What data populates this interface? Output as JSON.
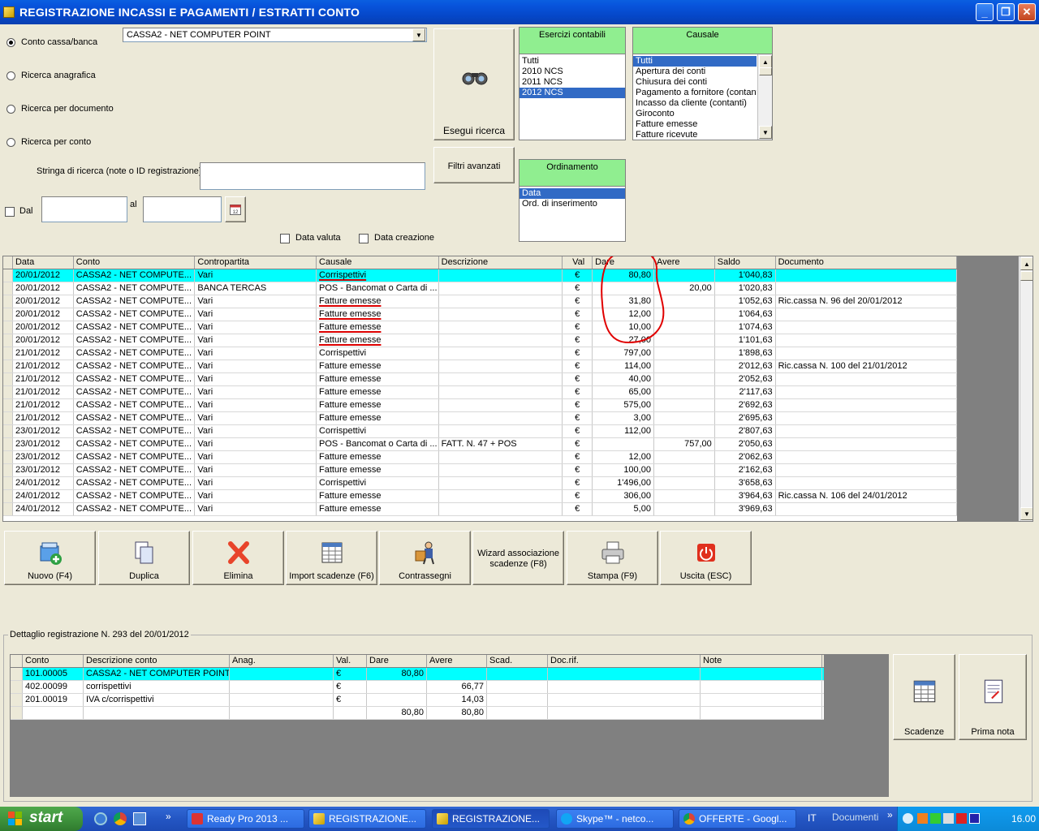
{
  "window": {
    "title": "REGISTRAZIONE INCASSI E PAGAMENTI / ESTRATTI CONTO"
  },
  "search": {
    "options": [
      "Conto cassa/banca",
      "Ricerca anagrafica",
      "Ricerca per documento",
      "Ricerca per conto"
    ],
    "selected_option": "Conto cassa/banca",
    "account_value": "CASSA2 - NET COMPUTER POINT",
    "search_string_label": "Stringa di ricerca (note o ID registrazione)",
    "search_string_value": "",
    "dal_label": "Dal",
    "al_label": "al",
    "data_valuta_label": "Data valuta",
    "data_creazione_label": "Data creazione",
    "run_button": "Esegui ricerca",
    "filters_button": "Filtri avanzati"
  },
  "esercizi": {
    "header": "Esercizi contabili",
    "items": [
      "Tutti",
      "2010 NCS",
      "2011 NCS",
      "2012 NCS"
    ],
    "selected": "2012 NCS"
  },
  "causale": {
    "header": "Causale",
    "items": [
      "Tutti",
      "Apertura dei conti",
      "Chiusura dei conti",
      "Pagamento a fornitore (contanti)",
      "Incasso da cliente (contanti)",
      "Giroconto",
      "Fatture emesse",
      "Fatture ricevute"
    ],
    "selected": "Tutti"
  },
  "ordinamento": {
    "header": "Ordinamento",
    "items": [
      "Data",
      "Ord. di inserimento"
    ],
    "selected": "Data"
  },
  "grid": {
    "columns": [
      "Data",
      "Conto",
      "Contropartita",
      "Causale",
      "Descrizione",
      "Val",
      "Dare",
      "Avere",
      "Saldo",
      "Documento"
    ],
    "rows": [
      {
        "data": "20/01/2012",
        "conto": "CASSA2 - NET COMPUTE...",
        "contro": "Vari",
        "causale": "Corrispettivi",
        "descr": "",
        "val": "€",
        "dare": "80,80",
        "avere": "",
        "saldo": "1'040,83",
        "doc": "",
        "sel": true,
        "mark": true
      },
      {
        "data": "20/01/2012",
        "conto": "CASSA2 - NET COMPUTE...",
        "contro": "BANCA TERCAS",
        "causale": "POS - Bancomat o Carta di ...",
        "descr": "",
        "val": "€",
        "dare": "",
        "avere": "20,00",
        "saldo": "1'020,83",
        "doc": ""
      },
      {
        "data": "20/01/2012",
        "conto": "CASSA2 - NET COMPUTE...",
        "contro": "Vari",
        "causale": "Fatture emesse",
        "descr": "",
        "val": "€",
        "dare": "31,80",
        "avere": "",
        "saldo": "1'052,63",
        "doc": "Ric.cassa N. 96 del 20/01/2012",
        "mark": true
      },
      {
        "data": "20/01/2012",
        "conto": "CASSA2 - NET COMPUTE...",
        "contro": "Vari",
        "causale": "Fatture emesse",
        "descr": "",
        "val": "€",
        "dare": "12,00",
        "avere": "",
        "saldo": "1'064,63",
        "doc": "",
        "mark": true
      },
      {
        "data": "20/01/2012",
        "conto": "CASSA2 - NET COMPUTE...",
        "contro": "Vari",
        "causale": "Fatture emesse",
        "descr": "",
        "val": "€",
        "dare": "10,00",
        "avere": "",
        "saldo": "1'074,63",
        "doc": "",
        "mark": true
      },
      {
        "data": "20/01/2012",
        "conto": "CASSA2 - NET COMPUTE...",
        "contro": "Vari",
        "causale": "Fatture emesse",
        "descr": "",
        "val": "€",
        "dare": "27,00",
        "avere": "",
        "saldo": "1'101,63",
        "doc": "",
        "mark": true
      },
      {
        "data": "21/01/2012",
        "conto": "CASSA2 - NET COMPUTE...",
        "contro": "Vari",
        "causale": "Corrispettivi",
        "descr": "",
        "val": "€",
        "dare": "797,00",
        "avere": "",
        "saldo": "1'898,63",
        "doc": ""
      },
      {
        "data": "21/01/2012",
        "conto": "CASSA2 - NET COMPUTE...",
        "contro": "Vari",
        "causale": "Fatture emesse",
        "descr": "",
        "val": "€",
        "dare": "114,00",
        "avere": "",
        "saldo": "2'012,63",
        "doc": "Ric.cassa N. 100 del 21/01/2012"
      },
      {
        "data": "21/01/2012",
        "conto": "CASSA2 - NET COMPUTE...",
        "contro": "Vari",
        "causale": "Fatture emesse",
        "descr": "",
        "val": "€",
        "dare": "40,00",
        "avere": "",
        "saldo": "2'052,63",
        "doc": ""
      },
      {
        "data": "21/01/2012",
        "conto": "CASSA2 - NET COMPUTE...",
        "contro": "Vari",
        "causale": "Fatture emesse",
        "descr": "",
        "val": "€",
        "dare": "65,00",
        "avere": "",
        "saldo": "2'117,63",
        "doc": ""
      },
      {
        "data": "21/01/2012",
        "conto": "CASSA2 - NET COMPUTE...",
        "contro": "Vari",
        "causale": "Fatture emesse",
        "descr": "",
        "val": "€",
        "dare": "575,00",
        "avere": "",
        "saldo": "2'692,63",
        "doc": ""
      },
      {
        "data": "21/01/2012",
        "conto": "CASSA2 - NET COMPUTE...",
        "contro": "Vari",
        "causale": "Fatture emesse",
        "descr": "",
        "val": "€",
        "dare": "3,00",
        "avere": "",
        "saldo": "2'695,63",
        "doc": ""
      },
      {
        "data": "23/01/2012",
        "conto": "CASSA2 - NET COMPUTE...",
        "contro": "Vari",
        "causale": "Corrispettivi",
        "descr": "",
        "val": "€",
        "dare": "112,00",
        "avere": "",
        "saldo": "2'807,63",
        "doc": ""
      },
      {
        "data": "23/01/2012",
        "conto": "CASSA2 - NET COMPUTE...",
        "contro": "Vari",
        "causale": "POS - Bancomat o Carta di ...",
        "descr": "FATT. N. 47 + POS",
        "val": "€",
        "dare": "",
        "avere": "757,00",
        "saldo": "2'050,63",
        "doc": ""
      },
      {
        "data": "23/01/2012",
        "conto": "CASSA2 - NET COMPUTE...",
        "contro": "Vari",
        "causale": "Fatture emesse",
        "descr": "",
        "val": "€",
        "dare": "12,00",
        "avere": "",
        "saldo": "2'062,63",
        "doc": ""
      },
      {
        "data": "23/01/2012",
        "conto": "CASSA2 - NET COMPUTE...",
        "contro": "Vari",
        "causale": "Fatture emesse",
        "descr": "",
        "val": "€",
        "dare": "100,00",
        "avere": "",
        "saldo": "2'162,63",
        "doc": ""
      },
      {
        "data": "24/01/2012",
        "conto": "CASSA2 - NET COMPUTE...",
        "contro": "Vari",
        "causale": "Corrispettivi",
        "descr": "",
        "val": "€",
        "dare": "1'496,00",
        "avere": "",
        "saldo": "3'658,63",
        "doc": ""
      },
      {
        "data": "24/01/2012",
        "conto": "CASSA2 - NET COMPUTE...",
        "contro": "Vari",
        "causale": "Fatture emesse",
        "descr": "",
        "val": "€",
        "dare": "306,00",
        "avere": "",
        "saldo": "3'964,63",
        "doc": "Ric.cassa N. 106 del 24/01/2012"
      },
      {
        "data": "24/01/2012",
        "conto": "CASSA2 - NET COMPUTE...",
        "contro": "Vari",
        "causale": "Fatture emesse",
        "descr": "",
        "val": "€",
        "dare": "5,00",
        "avere": "",
        "saldo": "3'969,63",
        "doc": ""
      }
    ]
  },
  "actions": [
    {
      "name": "nuovo",
      "label": "Nuovo (F4)"
    },
    {
      "name": "duplica",
      "label": "Duplica"
    },
    {
      "name": "elimina",
      "label": "Elimina"
    },
    {
      "name": "import",
      "label": "Import scadenze (F6)"
    },
    {
      "name": "contrassegni",
      "label": "Contrassegni"
    },
    {
      "name": "wizard",
      "label": "Wizard associazione scadenze (F8)"
    },
    {
      "name": "stampa",
      "label": "Stampa (F9)"
    },
    {
      "name": "uscita",
      "label": "Uscita (ESC)"
    }
  ],
  "detail": {
    "title": "Dettaglio registrazione N. 293 del 20/01/2012",
    "columns": [
      "Conto",
      "Descrizione conto",
      "Anag.",
      "Val.",
      "Dare",
      "Avere",
      "Scad.",
      "Doc.rif.",
      "Note"
    ],
    "rows": [
      {
        "conto": "101.00005",
        "descr": "CASSA2 - NET COMPUTER POINT",
        "anag": "",
        "val": "€",
        "dare": "80,80",
        "avere": "",
        "scad": "",
        "doc": "",
        "note": "",
        "sel": true
      },
      {
        "conto": "402.00099",
        "descr": "corrispettivi",
        "anag": "",
        "val": "€",
        "dare": "",
        "avere": "66,77",
        "scad": "",
        "doc": "",
        "note": ""
      },
      {
        "conto": "201.00019",
        "descr": "IVA c/corrispettivi",
        "anag": "",
        "val": "€",
        "dare": "",
        "avere": "14,03",
        "scad": "",
        "doc": "",
        "note": ""
      }
    ],
    "totals": {
      "dare": "80,80",
      "avere": "80,80"
    },
    "side_buttons": [
      "Scadenze",
      "Prima nota"
    ]
  },
  "taskbar": {
    "start": "start",
    "tasks": [
      "Ready Pro 2013 ...",
      "REGISTRAZIONE...",
      "REGISTRAZIONE...",
      "Skype™ - netco...",
      "OFFERTE - Googl..."
    ],
    "lang": "IT",
    "documents": "Documenti",
    "clock": "16.00"
  },
  "colors": {
    "title_bar": "#0855dd",
    "selected_row": "#00ffff",
    "list_header": "#90ee90",
    "annotation": "#e00000"
  }
}
